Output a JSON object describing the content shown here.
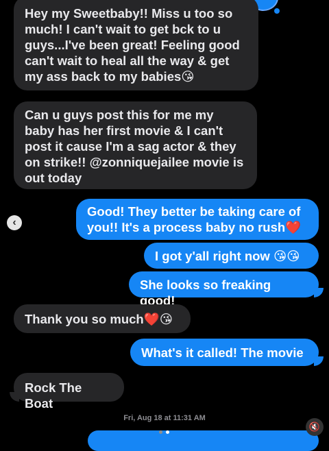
{
  "conversation": {
    "messages": [
      {
        "id": "m1",
        "side": "incoming",
        "text": "Hey my Sweetbaby!! Miss u too so\nmuch! I can't wait to get bck to u\nguys...I've been great! Feeling good\ncan't wait to heal all the way & get\nmy ass back to my babies",
        "emoji": "😘"
      },
      {
        "id": "m2",
        "side": "incoming",
        "text": "Can u guys post this for me my\nbaby has her first movie & I can't\npost it cause I'm a sag actor & they\non strike!! @zonniquejailee movie is\nout today",
        "emoji": ""
      },
      {
        "id": "m3",
        "side": "outgoing",
        "text": "Good! They better be taking care of\nyou!! It's a process baby no rush",
        "emoji": "❤️"
      },
      {
        "id": "m4",
        "side": "outgoing",
        "text": "I got y'all right now",
        "emoji": "😘😘"
      },
      {
        "id": "m5",
        "side": "outgoing",
        "text": "She looks so freaking good!",
        "emoji": ""
      },
      {
        "id": "m6",
        "side": "incoming",
        "text": "Thank you so much",
        "emoji": "❤️😘"
      },
      {
        "id": "m7",
        "side": "outgoing",
        "text": "What's it called! The movie",
        "emoji": ""
      },
      {
        "id": "m8",
        "side": "incoming",
        "text": "Rock The Boat",
        "emoji": ""
      }
    ],
    "timestamp": "Fri, Aug 18 at 11:31 AM"
  },
  "controls": {
    "prev_icon": "chevron-left-icon",
    "prev_glyph": "‹",
    "mute_icon": "speaker-muted-icon",
    "mute_glyph": "🔇",
    "pager_total": 2,
    "pager_active": 2
  },
  "colors": {
    "incoming_bubble": "#262628",
    "outgoing_bubble": "#1686f5",
    "background": "#000000"
  }
}
